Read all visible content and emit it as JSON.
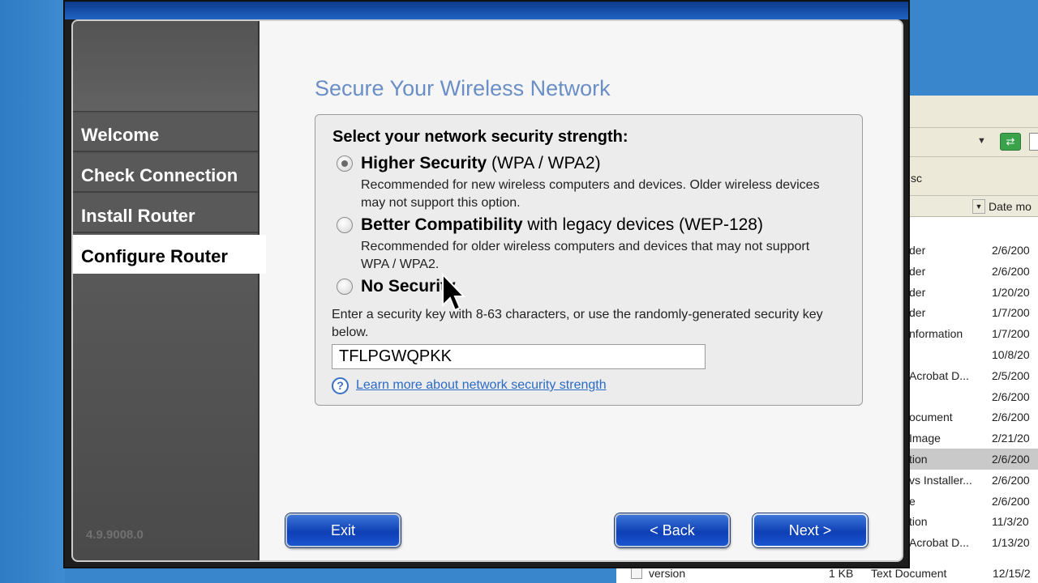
{
  "wizard": {
    "nav": [
      {
        "label": "Welcome"
      },
      {
        "label": "Check Connection"
      },
      {
        "label": "Install Router"
      },
      {
        "label": "Configure Router"
      }
    ],
    "active_step": "Configure Router",
    "version": "4.9.9008.0",
    "title": "Secure Your Wireless Network",
    "question": "Select your network security strength:",
    "options": [
      {
        "bold": "Higher Security",
        "rest": " (WPA / WPA2)",
        "desc": "Recommended for new wireless computers and devices. Older wireless devices may not support this option.",
        "selected": true
      },
      {
        "bold": "Better Compatibility",
        "rest": " with legacy devices (WEP-128)",
        "desc": "Recommended for older wireless computers and devices that may not support WPA / WPA2.",
        "selected": false
      },
      {
        "bold": "No Security",
        "rest": "",
        "desc": "",
        "selected": false
      }
    ],
    "key_label": "Enter a security key with 8-63 characters, or use the randomly-generated security key below.",
    "key_value": "TFLPGWQPKK",
    "help_link": "Learn more about network security strength",
    "buttons": {
      "exit": "Exit",
      "back": "< Back",
      "next": "Next >"
    }
  },
  "explorer": {
    "address_go": "⇄",
    "tasks_text": "sc",
    "column_header": "Date mo",
    "rows": [
      {
        "type": "der",
        "date": "2/6/200"
      },
      {
        "type": "der",
        "date": "2/6/200"
      },
      {
        "type": "der",
        "date": "1/20/20"
      },
      {
        "type": "der",
        "date": "1/7/200"
      },
      {
        "type": "nformation",
        "date": "1/7/200"
      },
      {
        "type": "",
        "date": "10/8/20"
      },
      {
        "type": "Acrobat D...",
        "date": "2/5/200"
      },
      {
        "type": "",
        "date": "2/6/200"
      },
      {
        "type": "ocument",
        "date": "2/6/200"
      },
      {
        "type": "Image",
        "date": "2/21/20"
      },
      {
        "type": "tion",
        "date": "2/6/200",
        "selected": true
      },
      {
        "type": "vs Installer...",
        "date": "2/6/200"
      },
      {
        "type": "e",
        "date": "2/6/200"
      },
      {
        "type": "tion",
        "date": "11/3/20"
      },
      {
        "type": "Acrobat D...",
        "date": "1/13/20"
      }
    ],
    "bottom_row": {
      "name": "version",
      "size": "1 KB",
      "type": "Text Document",
      "date": "12/15/2"
    }
  },
  "colors": {
    "accent": "#6a8ec6",
    "button": "#0e3fb5",
    "sidebar": "#595959"
  }
}
